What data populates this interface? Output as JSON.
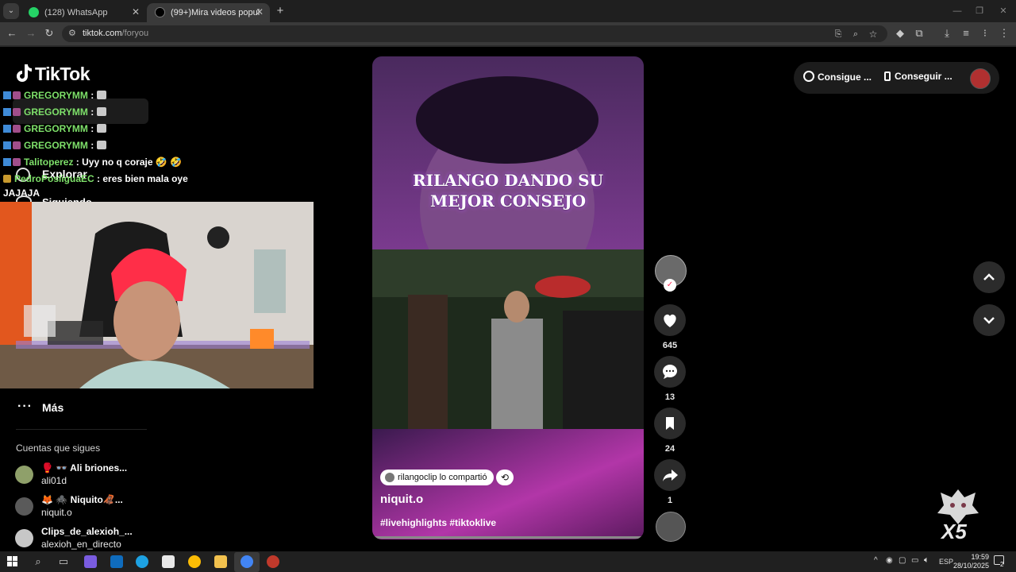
{
  "browser": {
    "tabs": [
      {
        "label": "(128) WhatsApp",
        "active": false
      },
      {
        "label": "(99+)Mira videos populares sob",
        "active": true
      }
    ],
    "url_domain": "tiktok.com",
    "url_path": "/foryou"
  },
  "tiktok": {
    "logo": "TikTok",
    "nav_explore": "Explorar",
    "nav_following": "Siguiendo",
    "more_label": "Más",
    "following_heading": "Cuentas que sigues",
    "followed_accounts": [
      {
        "name": "Ali briones...",
        "handle": "ali01d",
        "name_prefix": "🥊 👓 "
      },
      {
        "name": "Niquito🦧...",
        "handle": "niquit.o",
        "name_prefix": "🦊 🕷️ "
      },
      {
        "name": "Clips_de_alexioh_...",
        "handle": "alexioh_en_directo",
        "name_prefix": ""
      }
    ],
    "header_buttons": [
      {
        "label": "Consigue ...",
        "icon": "coin-icon"
      },
      {
        "label": "Conseguir ...",
        "icon": "phone-icon"
      }
    ]
  },
  "chat": [
    {
      "user": "GREGORYMM",
      "message": ""
    },
    {
      "user": "GREGORYMM",
      "message": ""
    },
    {
      "user": "GREGORYMM",
      "message": ""
    },
    {
      "user": "GREGORYMM",
      "message": ""
    },
    {
      "user": "Talitoperez",
      "message": "Uyy no q coraje 🤣 🤣"
    },
    {
      "user": "PedroPosliguaEC",
      "message": "eres bien mala oye"
    },
    {
      "user": "",
      "message": "JAJAJA"
    }
  ],
  "video": {
    "overlay_line1": "RILANGO DANDO SU",
    "overlay_line2": "MEJOR CONSEJO",
    "shared_label": "rilangoclip lo compartió",
    "author": "niquit.o",
    "hashtags": "#livehighlights #tiktoklive",
    "likes": "645",
    "comments": "13",
    "saves": "24",
    "shares": "1"
  },
  "overlay_badge": "X5",
  "taskbar": {
    "language": "ESP",
    "time": "19:59",
    "date": "28/10/2025",
    "notifications": "2"
  },
  "colors": {
    "chat_user": "#7ee06a",
    "accent": "#fe2c55",
    "video_purple": "#6b2a8c"
  }
}
